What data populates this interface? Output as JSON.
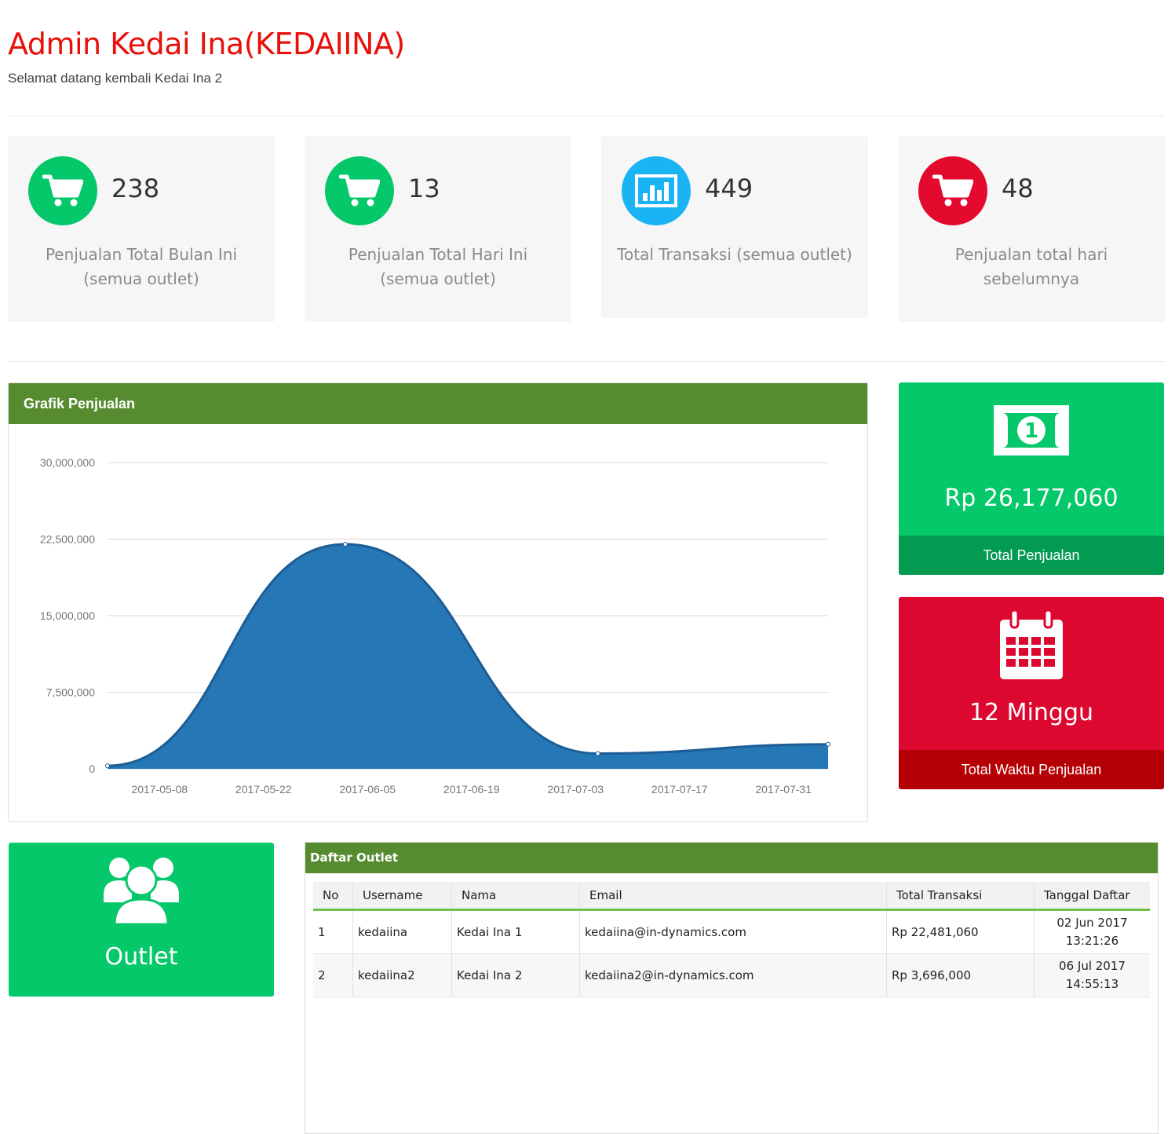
{
  "header": {
    "title": "Admin Kedai Ina(KEDAIINA)",
    "subtitle": "Selamat datang kembali Kedai Ina 2"
  },
  "stats": [
    {
      "value": "238",
      "label": "Penjualan Total Bulan Ini (semua outlet)",
      "icon": "cart-icon",
      "color": "#04c869"
    },
    {
      "value": "13",
      "label": "Penjualan Total Hari Ini (semua outlet)",
      "icon": "cart-icon",
      "color": "#04c869"
    },
    {
      "value": "449",
      "label": "Total Transaksi (semua outlet)",
      "icon": "bar-chart-icon",
      "color": "#1ab4f5"
    },
    {
      "value": "48",
      "label": "Penjualan total hari sebelumnya",
      "icon": "cart-icon",
      "color": "#e30a2e"
    }
  ],
  "sales_chart_panel": {
    "title": "Grafik Penjualan"
  },
  "chart_data": {
    "type": "area",
    "title": "",
    "xlabel": "",
    "ylabel": "",
    "x_ticks": [
      "2017-05-08",
      "2017-05-22",
      "2017-06-05",
      "2017-06-19",
      "2017-07-03",
      "2017-07-17",
      "2017-07-31"
    ],
    "y_ticks": [
      "0",
      "7,500,000",
      "15,000,000",
      "22,500,000",
      "30,000,000"
    ],
    "ylim": [
      0,
      30000000
    ],
    "xlim": [
      "2017-05-01",
      "2017-08-06"
    ],
    "points": [
      {
        "x": "2017-05-01",
        "y": 300000
      },
      {
        "x": "2017-06-02",
        "y": 22000000
      },
      {
        "x": "2017-07-06",
        "y": 1500000
      },
      {
        "x": "2017-08-06",
        "y": 2400000
      }
    ],
    "color": "#2677b5",
    "grid": true
  },
  "total_sales_tile": {
    "value": "Rp 26,177,060",
    "label": "Total Penjualan",
    "icon": "money-icon"
  },
  "total_time_tile": {
    "value": "12 Minggu",
    "label": "Total Waktu Penjualan",
    "icon": "calendar-icon"
  },
  "outlet_tile": {
    "label": "Outlet",
    "icon": "users-icon"
  },
  "outlet_panel": {
    "title": "Daftar Outlet",
    "columns": [
      "No",
      "Username",
      "Nama",
      "Email",
      "Total Transaksi",
      "Tanggal Daftar"
    ],
    "rows": [
      {
        "no": "1",
        "username": "kedaiina",
        "nama": "Kedai Ina 1",
        "email": "kedaiina@in-dynamics.com",
        "total": "Rp 22,481,060",
        "date": "02 Jun 2017",
        "time": "13:21:26"
      },
      {
        "no": "2",
        "username": "kedaiina2",
        "nama": "Kedai Ina 2",
        "email": "kedaiina2@in-dynamics.com",
        "total": "Rp 3,696,000",
        "date": "06 Jul 2017",
        "time": "14:55:13"
      }
    ]
  },
  "colors": {
    "green": "#04c869",
    "green_dark": "#039b52",
    "red": "#dc0830",
    "red_dark": "#b40004",
    "panel_header": "#568b2f",
    "title_red": "#e8100a"
  }
}
